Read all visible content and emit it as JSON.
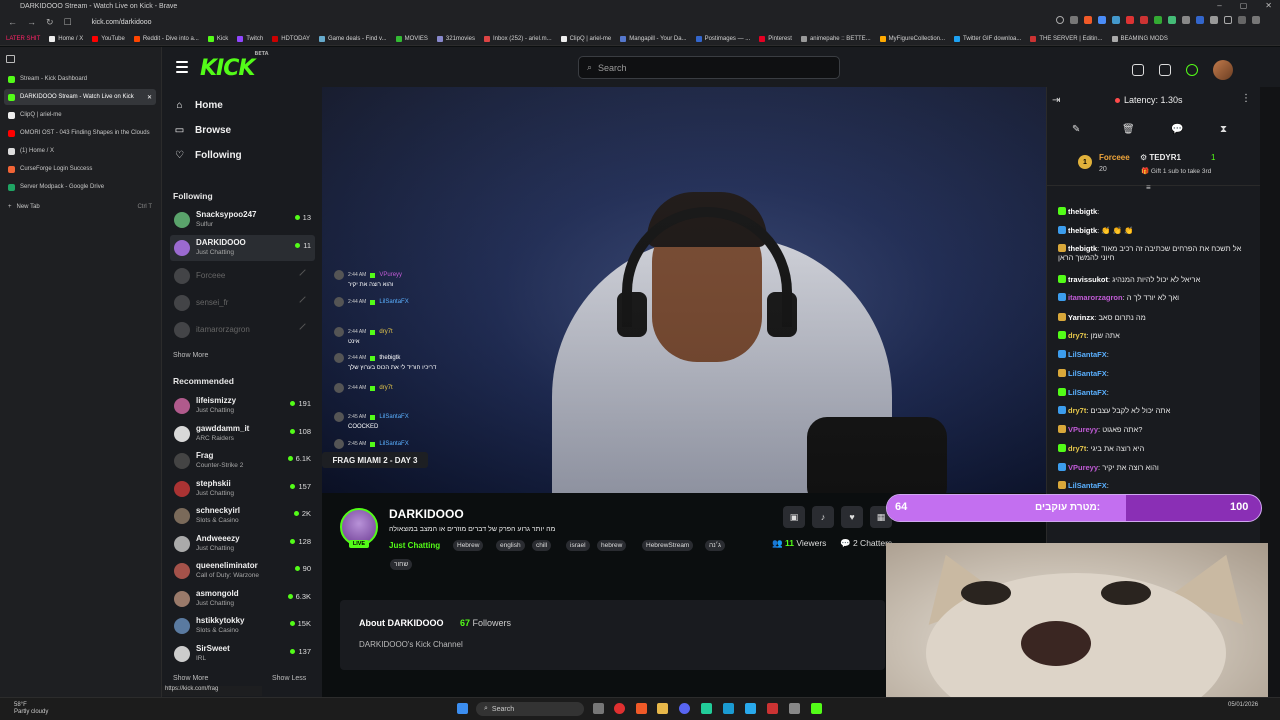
{
  "browser": {
    "window_title": "DARKIDOOO Stream - Watch Live on Kick - Brave",
    "url": "kick.com/darkidooo",
    "bookmarks": [
      "LATER SHIT",
      "Home / X",
      "YouTube",
      "Reddit - Dive into a...",
      "Kick",
      "Twitch",
      "HDTODAY",
      "Game deals - Find v...",
      "MOVIES",
      "321movies",
      "Inbox (252) - ariel.m...",
      "ClipQ | ariel-me",
      "Mangapill - Your Da...",
      "Postimages — ...",
      "Pinterest",
      "animepahe :: BETTE...",
      "MyFigureCollection...",
      "Twitter GIF downloa...",
      "THE SERVER | Editin...",
      "BEAMING MODS"
    ],
    "tabs": [
      "Stream - Kick Dashboard",
      "DARKIDOOO Stream - Watch Live on Kick",
      "ClipQ | ariel-me",
      "OMORI OST - 043 Finding Shapes in the Clouds",
      "(1) Home / X",
      "CurseForge Login Success",
      "Server Modpack - Google Drive",
      "New Tab"
    ],
    "new_tab_shortcut": "Ctrl T",
    "status_url": "https://kick.com/frag"
  },
  "kick": {
    "logo": "KICK",
    "logo_beta": "BETA",
    "search_placeholder": "Search",
    "nav": {
      "home": "Home",
      "browse": "Browse",
      "following": "Following"
    },
    "following_title": "Following",
    "following": [
      {
        "name": "Snacksypoo247",
        "cat": "Sulfur",
        "viewers": "13",
        "live": true,
        "color": "#5aa36b"
      },
      {
        "name": "DARKIDOOO",
        "cat": "Just Chatting",
        "viewers": "11",
        "live": true,
        "color": "#9b6ad0"
      },
      {
        "name": "Forceee",
        "cat": "",
        "viewers": "",
        "live": false,
        "color": "#777"
      },
      {
        "name": "sensei_fr",
        "cat": "",
        "viewers": "",
        "live": false,
        "color": "#777"
      },
      {
        "name": "itamarorzagron",
        "cat": "",
        "viewers": "",
        "live": false,
        "color": "#777"
      }
    ],
    "show_more": "Show More",
    "recommended_title": "Recommended",
    "recommended": [
      {
        "name": "lifeismizzy",
        "cat": "Just Chatting",
        "viewers": "191",
        "color": "#b05a8c"
      },
      {
        "name": "gawddamm_it",
        "cat": "ARC Raiders",
        "viewers": "108",
        "color": "#d8d8d8"
      },
      {
        "name": "Frag",
        "cat": "Counter-Strike 2",
        "viewers": "6.1K",
        "color": "#444"
      },
      {
        "name": "stephskii",
        "cat": "Just Chatting",
        "viewers": "157",
        "color": "#a33"
      },
      {
        "name": "schneckyirl",
        "cat": "Slots & Casino",
        "viewers": "2K",
        "color": "#7a6a5a"
      },
      {
        "name": "Andweeezy",
        "cat": "Just Chatting",
        "viewers": "128",
        "color": "#aaa"
      },
      {
        "name": "queeneliminator",
        "cat": "Call of Duty: Warzone",
        "viewers": "90",
        "color": "#a4524a"
      },
      {
        "name": "asmongold",
        "cat": "Just Chatting",
        "viewers": "6.3K",
        "color": "#9a7a6a"
      },
      {
        "name": "hstikkytokky",
        "cat": "Slots & Casino",
        "viewers": "15K",
        "color": "#5a7aa0"
      },
      {
        "name": "SirSweet",
        "cat": "IRL",
        "viewers": "137",
        "color": "#ccc"
      }
    ],
    "show_more_2": "Show More",
    "show_less": "Show Less",
    "tooltip": "FRAG MIAMI 2 - DAY 3",
    "stream": {
      "streamer": "DARKIDOOO",
      "live": "LIVE",
      "title": "מה יותר גרוע הפרק של דברים מוזרים או המצב במוצאולה",
      "category": "Just Chatting",
      "tags": [
        "Hebrew",
        "english",
        "chill",
        "israel",
        "hebrew",
        "HebrewStream",
        "ג׳נה",
        "שחור"
      ],
      "viewers_count": "11",
      "viewers_label": "Viewers",
      "chatters": "2 Chatters",
      "about_title": "About DARKIDOOO",
      "followers_count": "67",
      "followers_label": "Followers",
      "about_desc": "DARKIDOOO's Kick Channel"
    },
    "overlay_chat": [
      {
        "time": "2:44 AM",
        "user": "VPureyy",
        "text": "והוא רוצה את יקיר",
        "color": "#c15bd6"
      },
      {
        "time": "2:44 AM",
        "user": "LilSantaFX",
        "text": "",
        "color": "#5ab0ff"
      },
      {
        "time": "2:44 AM",
        "user": "dry7t",
        "text": "אינט",
        "color": "#e7c84b"
      },
      {
        "time": "2:44 AM",
        "user": "thebigtk",
        "text": "דריכיו חוריד לי את הכוס בערוץ שלך",
        "color": "#fff"
      },
      {
        "time": "2:44 AM",
        "user": "dry7t",
        "text": "",
        "color": "#e7c84b"
      },
      {
        "time": "2:45 AM",
        "user": "LilSantaFX",
        "text": "COOCKED",
        "color": "#5ab0ff"
      },
      {
        "time": "2:45 AM",
        "user": "LilSantaFX",
        "text": "",
        "color": "#5ab0ff"
      }
    ],
    "chat": {
      "latency": "Latency: 1.30s",
      "pinned_user": "Forceee",
      "pinned_count": "20",
      "pinned_gift_rank": "1",
      "pinned_target": "TEDYR1",
      "pinned_target_count": "1",
      "pinned_text": "Gift 1 sub to take 3rd",
      "messages": [
        {
          "user": "thebigtk",
          "text": "",
          "color": "#fff"
        },
        {
          "user": "thebigtk",
          "text": "👏 👏 👏",
          "color": "#fff"
        },
        {
          "user": "thebigtk",
          "text": "אל תשכח את הפרחים שכתיבה זה רכיב מאוד חיוני להמשך הראן",
          "color": "#fff"
        },
        {
          "user": "travissukot",
          "text": "אריאל לא יכול להיות המנהיג",
          "color": "#fff"
        },
        {
          "user": "itamarorzagron",
          "text": "ואך לא יורד לך ה",
          "color": "#c15bd6"
        },
        {
          "user": "Yarinzx",
          "text": "מה נתרום סאב",
          "color": "#fff"
        },
        {
          "user": "dry7t",
          "text": "אתה שמן",
          "color": "#e7c84b"
        },
        {
          "user": "LilSantaFX",
          "text": "",
          "color": "#5ab0ff"
        },
        {
          "user": "LilSantaFX",
          "text": "",
          "color": "#5ab0ff"
        },
        {
          "user": "LilSantaFX",
          "text": "",
          "color": "#5ab0ff"
        },
        {
          "user": "dry7t",
          "text": "אתה יכול לא לקבל עצבים",
          "color": "#e7c84b"
        },
        {
          "user": "VPureyy",
          "text": "אתה פאגוט?",
          "color": "#c15bd6"
        },
        {
          "user": "dry7t",
          "text": "היא רוצה את ביגי",
          "color": "#e7c84b"
        },
        {
          "user": "VPureyy",
          "text": "והוא רוצה את יקיר",
          "color": "#c15bd6"
        },
        {
          "user": "LilSantaFX",
          "text": "",
          "color": "#5ab0ff"
        }
      ]
    },
    "goal": {
      "current": "64",
      "title": "מטרת עוקבים:",
      "target": "100",
      "progress": 0.64
    }
  },
  "taskbar": {
    "weather_temp": "58°F",
    "weather_desc": "Partly cloudy",
    "search": "Search",
    "date": "05/01/2026"
  }
}
